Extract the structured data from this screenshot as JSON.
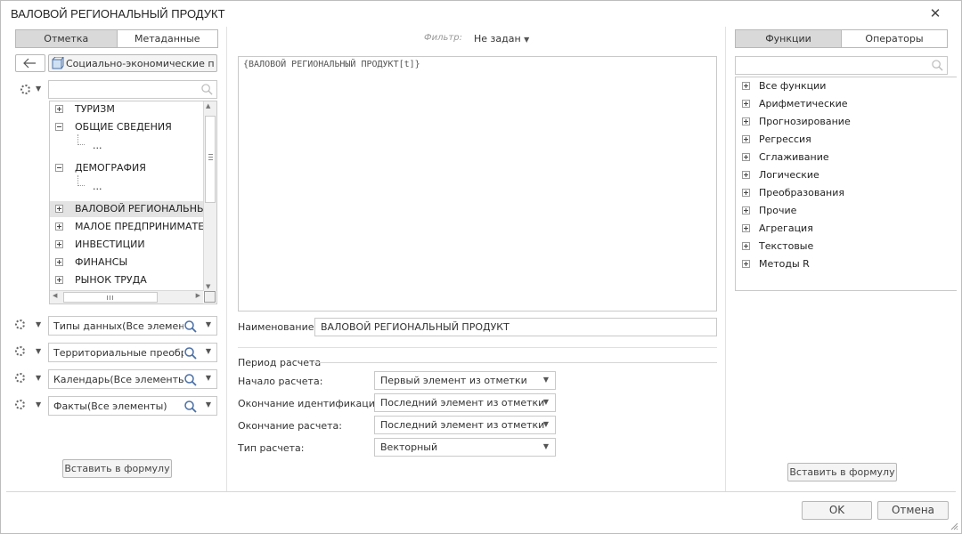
{
  "window": {
    "title": "ВАЛОВОЙ РЕГИОНАЛЬНЫЙ ПРОДУКТ"
  },
  "left": {
    "tabs": [
      "Отметка",
      "Метаданные"
    ],
    "source_label": "Социально-экономические по...",
    "tree": [
      {
        "label": "ТУРИЗМ",
        "level": 0,
        "expander": "plus"
      },
      {
        "label": "ОБЩИЕ СВЕДЕНИЯ",
        "level": 0,
        "expander": "minus"
      },
      {
        "label": "...",
        "level": 1,
        "expander": "none"
      },
      {
        "label": "ДЕМОГРАФИЯ",
        "level": 0,
        "expander": "minus"
      },
      {
        "label": "...",
        "level": 1,
        "expander": "none"
      },
      {
        "label": "ВАЛОВОЙ РЕГИОНАЛЬНЫЙ ПРОДУКТ",
        "level": 0,
        "expander": "plus",
        "selected": true
      },
      {
        "label": "МАЛОЕ ПРЕДПРИНИМАТЕЛЬСТВО",
        "level": 0,
        "expander": "plus"
      },
      {
        "label": "ИНВЕСТИЦИИ",
        "level": 0,
        "expander": "plus"
      },
      {
        "label": "ФИНАНСЫ",
        "level": 0,
        "expander": "plus"
      },
      {
        "label": "РЫНОК ТРУДА",
        "level": 0,
        "expander": "plus"
      }
    ],
    "dimensions": [
      "Типы данных(Все элементы)",
      "Территориальные преобразования",
      "Календарь(Все элементы)",
      "Факты(Все элементы)"
    ],
    "insert_button": "Вставить в формулу"
  },
  "middle": {
    "filter_label": "Фильтр:",
    "filter_value": "Не задан",
    "formula": "{ВАЛОВОЙ РЕГИОНАЛЬНЫЙ ПРОДУКТ[t]}",
    "name_label": "Наименование:",
    "name_value": "ВАЛОВОЙ РЕГИОНАЛЬНЫЙ ПРОДУКТ",
    "period_title": "Период расчета",
    "fields": [
      {
        "label": "Начало расчета:",
        "value": "Первый элемент из отметки"
      },
      {
        "label": "Окончание идентификации:",
        "value": "Последний элемент из отметки"
      },
      {
        "label": "Окончание расчета:",
        "value": "Последний элемент из отметки"
      },
      {
        "label": "Тип расчета:",
        "value": "Векторный"
      }
    ]
  },
  "right": {
    "tabs": [
      "Функции",
      "Операторы"
    ],
    "functions": [
      "Все функции",
      "Арифметические",
      "Прогнозирование",
      "Регрессия",
      "Сглаживание",
      "Логические",
      "Преобразования",
      "Прочие",
      "Агрегация",
      "Текстовые",
      "Методы R"
    ],
    "insert_button": "Вставить в формулу"
  },
  "footer": {
    "ok": "OK",
    "cancel": "Отмена"
  },
  "colors": {
    "tab_active": "#d9d9d9",
    "border": "#c9c9c9",
    "selection": "#e3e3e3",
    "search_icon": "#4a6fa5"
  },
  "icons": [
    "close-icon",
    "back-arrow-icon",
    "cube-icon",
    "search-icon",
    "gear-icon",
    "chevron-down-icon",
    "expand-icon",
    "collapse-icon",
    "resize-grip-icon"
  ]
}
